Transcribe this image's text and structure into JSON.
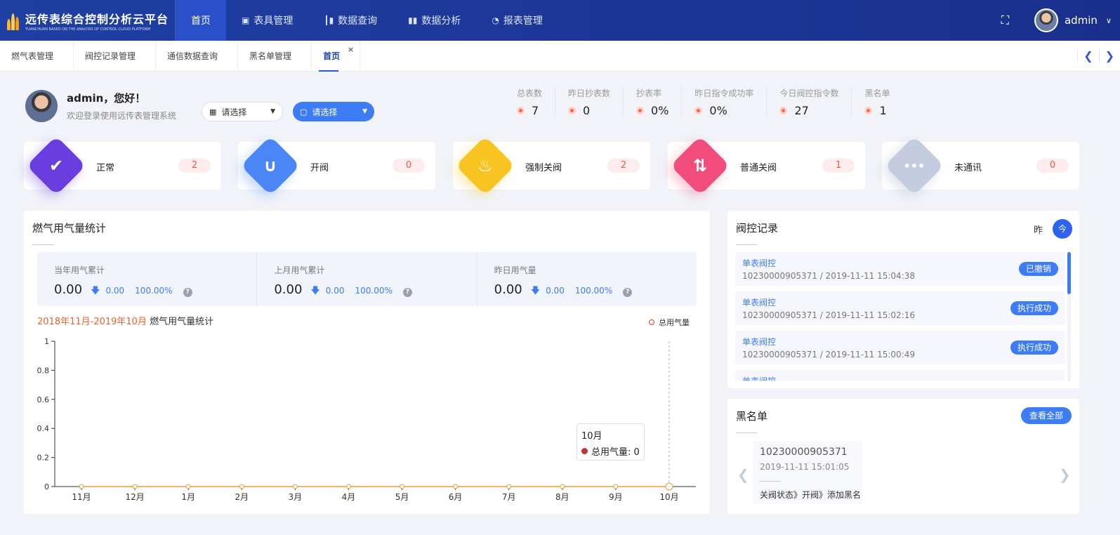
{
  "header": {
    "logo_title": "远传表综合控制分析云平台",
    "logo_subtitle": "YUANCHUAN BASED ON THE ANALYSIS OF CONTROL CLOUD PLATFORM",
    "nav": [
      {
        "label": "首页",
        "icon": "home"
      },
      {
        "label": "表具管理",
        "icon": "save-icon"
      },
      {
        "label": "数据查询",
        "icon": "chart-bar-icon"
      },
      {
        "label": "数据分析",
        "icon": "bar-chart-icon"
      },
      {
        "label": "报表管理",
        "icon": "pie-chart-icon"
      }
    ],
    "user": "admin"
  },
  "tabs": {
    "items": [
      "燃气表管理",
      "阀控记录管理",
      "通信数据查询",
      "黑名单管理",
      "首页"
    ],
    "close": "×"
  },
  "welcome": {
    "greeting": "admin，您好！",
    "subtitle": "欢迎登录使用远传表管理系统"
  },
  "selects": {
    "company": "请选择",
    "area": "请选择"
  },
  "stats": [
    {
      "label": "总表数",
      "value": "7"
    },
    {
      "label": "昨日抄表数",
      "value": "0"
    },
    {
      "label": "抄表率",
      "value": "0%"
    },
    {
      "label": "昨日指令成功率",
      "value": "0%"
    },
    {
      "label": "今日阀控指令数",
      "value": "27"
    },
    {
      "label": "黑名单",
      "value": "1"
    }
  ],
  "status_cards": [
    {
      "label": "正常",
      "count": "2",
      "color": "#6a3de0",
      "icon": "check-icon",
      "glyph": "✔"
    },
    {
      "label": "开阀",
      "count": "0",
      "color": "#4a86f5",
      "icon": "magnet-icon",
      "glyph": "∪"
    },
    {
      "label": "强制关阀",
      "count": "2",
      "color": "#f8c422",
      "icon": "fire-icon",
      "glyph": "♨"
    },
    {
      "label": "普通关阀",
      "count": "1",
      "color": "#f04d7c",
      "icon": "swap-icon",
      "glyph": "⇅"
    },
    {
      "label": "未通讯",
      "count": "0",
      "color": "#c6cce0",
      "icon": "more-icon",
      "glyph": "•••"
    }
  ],
  "gas": {
    "title": "燃气用气量统计",
    "summary": [
      {
        "label": "当年用气累计",
        "value": "0.00",
        "change": "0.00",
        "percent": "100.00%"
      },
      {
        "label": "上月用气累计",
        "value": "0.00",
        "change": "0.00",
        "percent": "100.00%"
      },
      {
        "label": "昨日用气量",
        "value": "0.00",
        "change": "0.00",
        "percent": "100.00%"
      }
    ],
    "help": "?",
    "range": "2018年11月-2019年10月",
    "chart_title_suffix": "燃气用气量统计",
    "tooltip": {
      "month": "10月",
      "text": "总用气量: 0"
    }
  },
  "chart_data": {
    "type": "line",
    "categories": [
      "11月",
      "12月",
      "1月",
      "2月",
      "3月",
      "4月",
      "5月",
      "6月",
      "7月",
      "8月",
      "9月",
      "10月"
    ],
    "series": [
      {
        "name": "总用气量",
        "values": [
          0,
          0,
          0,
          0,
          0,
          0,
          0,
          0,
          0,
          0,
          0,
          0
        ]
      }
    ],
    "ylim": [
      0,
      1
    ],
    "yticks": [
      "0",
      "0.2",
      "0.4",
      "0.6",
      "0.8",
      "1"
    ],
    "legend": "top-right",
    "line_color": "#f09a32",
    "highlight": "10月"
  },
  "valve": {
    "title": "阀控记录",
    "btn_yesterday": "昨",
    "btn_today": "今",
    "records": [
      {
        "name": "单表阀控",
        "meta": "10230000905371 / 2019-11-11 15:04:38",
        "status": "已撤销"
      },
      {
        "name": "单表阀控",
        "meta": "10230000905371 / 2019-11-11 15:02:16",
        "status": "执行成功"
      },
      {
        "name": "单表阀控",
        "meta": "10230000905371 / 2019-11-11 15:00:49",
        "status": "执行成功"
      },
      {
        "name": "单表阀控",
        "meta": "",
        "status": ""
      }
    ]
  },
  "blacklist": {
    "title": "黑名单",
    "view_all": "查看全部",
    "number": "10230000905371",
    "date": "2019-11-11 15:01:05",
    "info": "关阀状态》开阀》添加黑名"
  }
}
